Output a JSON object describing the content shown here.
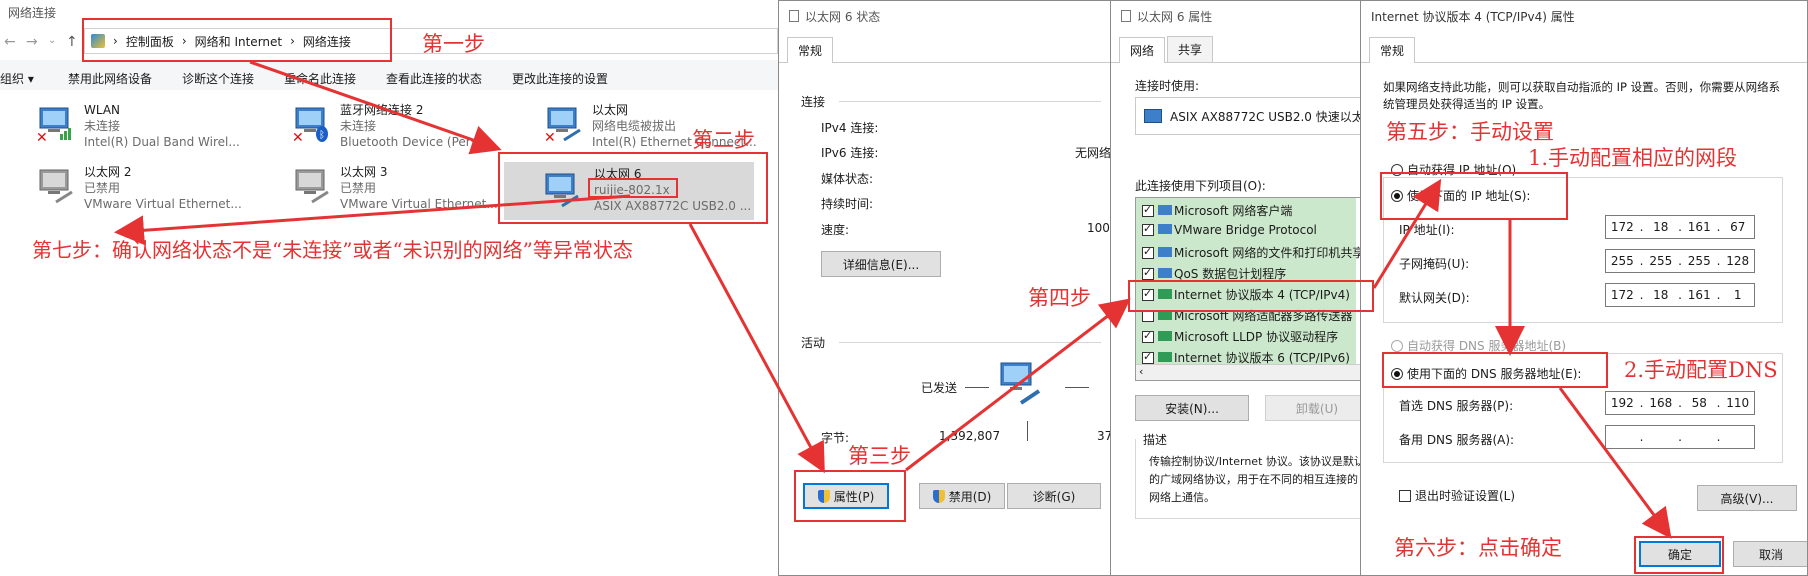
{
  "explorer": {
    "title": "网络连接",
    "breadcrumb": [
      "控制面板",
      "网络和 Internet",
      "网络连接"
    ],
    "toolbar": [
      "组织 ▾",
      "禁用此网络设备",
      "诊断这个连接",
      "重命名此连接",
      "查看此连接的状态",
      "更改此连接的设置"
    ],
    "adapters": [
      {
        "name": "WLAN",
        "status": "未连接",
        "device": "Intel(R) Dual Band Wirel..."
      },
      {
        "name": "蓝牙网络连接 2",
        "status": "未连接",
        "device": "Bluetooth Device (Perso..."
      },
      {
        "name": "以太网",
        "status": "网络电缆被拔出",
        "device": "Intel(R) Ethernet Connect..."
      },
      {
        "name": "以太网 2",
        "status": "已禁用",
        "device": "VMware Virtual Ethernet..."
      },
      {
        "name": "以太网 3",
        "status": "已禁用",
        "device": "VMware Virtual Ethernet..."
      },
      {
        "name": "以太网 6",
        "status": "ruijie-802.1x",
        "device": "ASIX AX88772C USB2.0 ..."
      }
    ]
  },
  "status_dialog": {
    "title": "以太网 6 状态",
    "tab": "常规",
    "connection_label": "连接",
    "rows": [
      {
        "label": "IPv4 连接:",
        "value": ""
      },
      {
        "label": "IPv6 连接:",
        "value": "无网络"
      },
      {
        "label": "媒体状态:",
        "value": ""
      },
      {
        "label": "持续时间:",
        "value": ""
      },
      {
        "label": "速度:",
        "value": "100"
      }
    ],
    "details_button": "详细信息(E)...",
    "activity_label": "活动",
    "sent_label": "已发送",
    "bytes_label": "字节:",
    "bytes_sent": "1,392,807",
    "bytes_recv": "37",
    "properties_button": "属性(P)",
    "disable_button": "禁用(D)",
    "diagnose_button": "诊断(G)"
  },
  "props_dialog": {
    "title": "以太网 6 属性",
    "tabs": [
      "网络",
      "共享"
    ],
    "connect_using_label": "连接时使用:",
    "adapter_name": "ASIX AX88772C USB2.0 快速以太",
    "items_label": "此连接使用下列项目(O):",
    "items": [
      {
        "label": "Microsoft 网络客户端",
        "checked": true
      },
      {
        "label": "VMware Bridge Protocol",
        "checked": true
      },
      {
        "label": "Microsoft 网络的文件和打印机共享",
        "checked": true
      },
      {
        "label": "QoS 数据包计划程序",
        "checked": true
      },
      {
        "label": "Internet 协议版本 4 (TCP/IPv4)",
        "checked": true
      },
      {
        "label": "Microsoft 网络适配器多路传送器",
        "checked": false
      },
      {
        "label": "Microsoft LLDP 协议驱动程序",
        "checked": true
      },
      {
        "label": "Internet 协议版本 6 (TCP/IPv6)",
        "checked": true
      }
    ],
    "install_button": "安装(N)...",
    "uninstall_button": "卸载(U)",
    "description_label": "描述",
    "description_text": "传输控制协议/Internet 协议。该协议是默认的广域网络协议，用于在不同的相互连接的网络上通信。"
  },
  "ipv4_dialog": {
    "title": "Internet 协议版本 4 (TCP/IPv4) 属性",
    "tab": "常规",
    "intro": "如果网络支持此功能，则可以获取自动指派的 IP 设置。否则，你需要从网络系统管理员处获得适当的 IP 设置。",
    "auto_ip": "自动获得 IP 地址(O)",
    "manual_ip": "使用下面的 IP 地址(S):",
    "ip_label": "IP 地址(I):",
    "mask_label": "子网掩码(U):",
    "gateway_label": "默认网关(D):",
    "ip": [
      "172",
      "18",
      "161",
      "67"
    ],
    "mask": [
      "255",
      "255",
      "255",
      "128"
    ],
    "gateway": [
      "172",
      "18",
      "161",
      "1"
    ],
    "auto_dns": "自动获得 DNS 服务器地址(B)",
    "manual_dns": "使用下面的 DNS 服务器地址(E):",
    "pref_dns_label": "首选 DNS 服务器(P):",
    "alt_dns_label": "备用 DNS 服务器(A):",
    "pref_dns": [
      "192",
      "168",
      "58",
      "110"
    ],
    "alt_dns": [
      "",
      "",
      "",
      ""
    ],
    "validate_label": "退出时验证设置(L)",
    "advanced_button": "高级(V)...",
    "ok_button": "确定",
    "cancel_button": "取消"
  },
  "annotations": {
    "step1": "第一步",
    "step2": "第二步",
    "step3": "第三步",
    "step4": "第四步",
    "step5": "第五步：手动设置",
    "step5a": "1.手动配置相应的网段",
    "step5b": "2.手动配置DNS",
    "step6": "第六步：点击确定",
    "step7": "第七步：确认网络状态不是“未连接”或者“未识别的网络”等异常状态"
  },
  "colors": {
    "annotation": "#e53333",
    "accent": "#0078d7",
    "selection": "#cce8cc",
    "highlight": "#d9d9d9"
  }
}
